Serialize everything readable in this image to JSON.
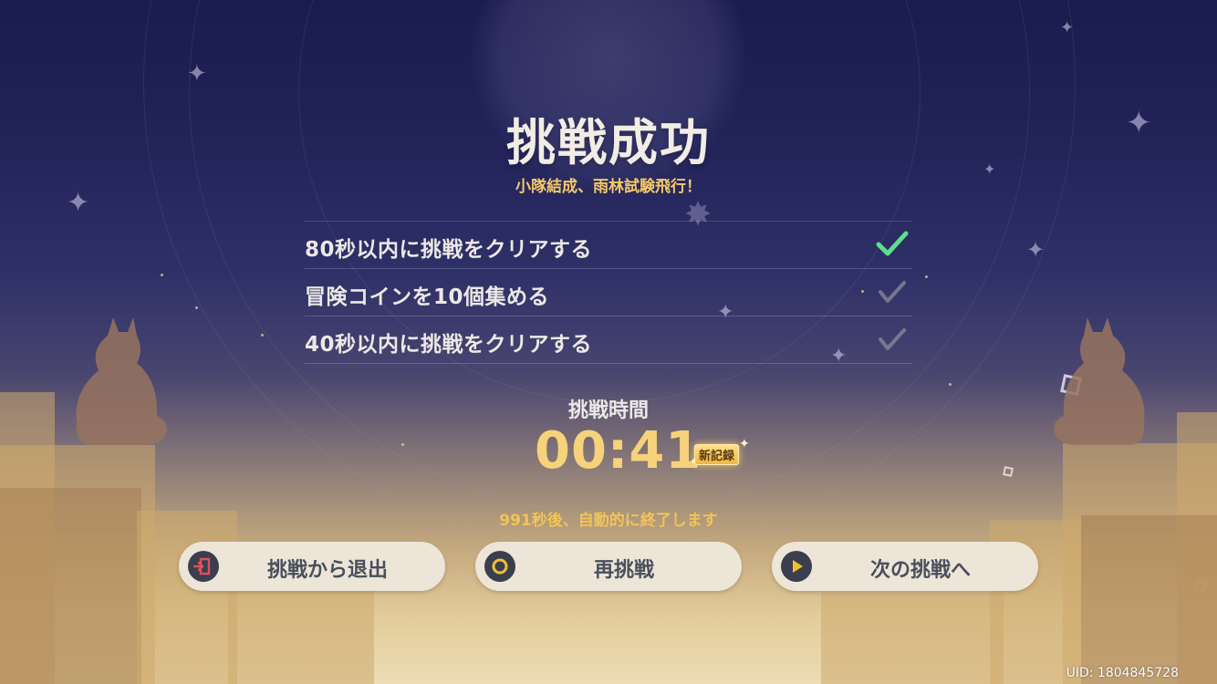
{
  "title": "挑戦成功",
  "subtitle": "小隊結成、雨林試験飛行！",
  "objectives": [
    {
      "text": "80秒以内に挑戦をクリアする",
      "completed": true
    },
    {
      "text": "冒険コインを10個集める",
      "completed": false
    },
    {
      "text": "40秒以内に挑戦をクリアする",
      "completed": false
    }
  ],
  "time": {
    "label": "挑戦時間",
    "value": "00:41",
    "badge": "新記録"
  },
  "auto_close_text": "991秒後、自動的に終了します",
  "buttons": {
    "exit": {
      "label": "挑戦から退出",
      "icon": "exit-door-icon",
      "icon_color": "#e0505a"
    },
    "retry": {
      "label": "再挑戦",
      "icon": "ring-icon",
      "icon_color": "#f2c030"
    },
    "next": {
      "label": "次の挑戦へ",
      "icon": "play-icon",
      "icon_color": "#f2c030"
    }
  },
  "uid": "UID: 1804845728",
  "colors": {
    "title": "#f2ede4",
    "accent_gold": "#f4c868",
    "check_done": "#5ee08a",
    "check_pending": "#8a8d9c",
    "button_bg": "#ece5d8"
  }
}
